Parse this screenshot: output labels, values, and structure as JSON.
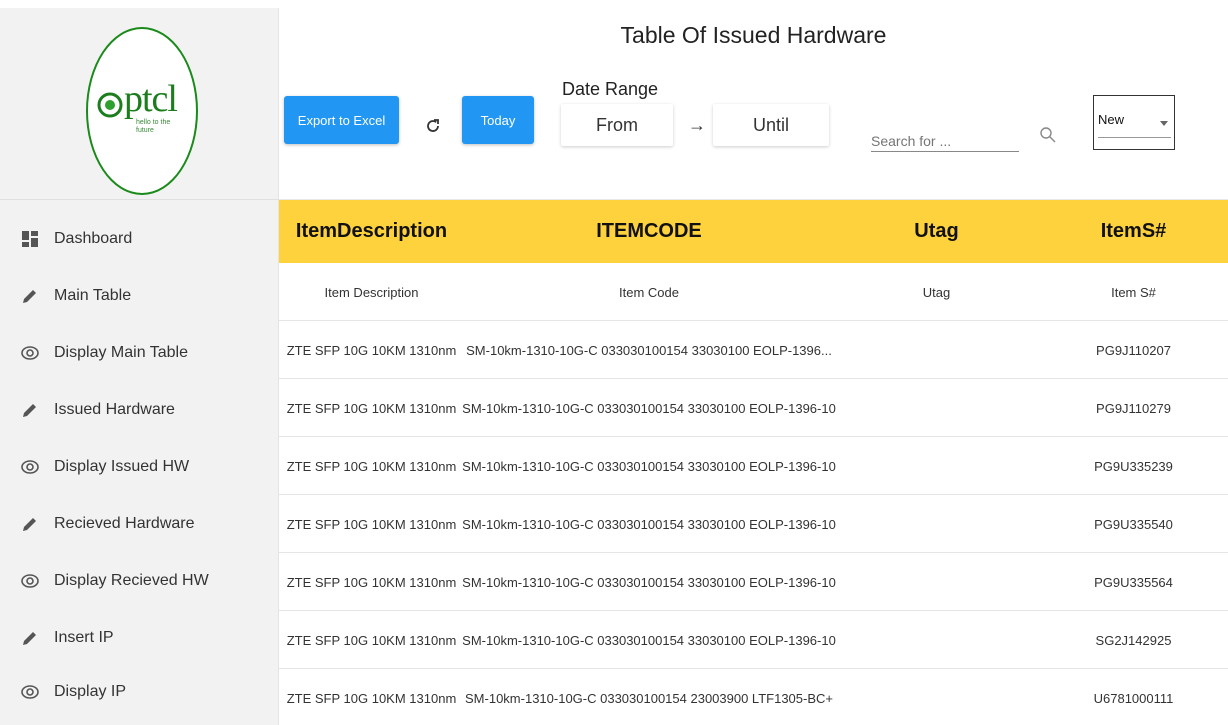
{
  "logo": {
    "text": "ptcl",
    "tagline": "hello to the\nfuture",
    "brand_color": "#1b7d1b"
  },
  "sidebar": {
    "items": [
      {
        "label": "Dashboard",
        "icon": "dashboard-icon"
      },
      {
        "label": "Main Table",
        "icon": "pencil-icon"
      },
      {
        "label": "Display Main Table",
        "icon": "eye-icon"
      },
      {
        "label": "Issued Hardware",
        "icon": "pencil-icon"
      },
      {
        "label": "Display Issued HW",
        "icon": "eye-icon"
      },
      {
        "label": "Recieved Hardware",
        "icon": "pencil-icon"
      },
      {
        "label": "Display Recieved HW",
        "icon": "eye-icon"
      },
      {
        "label": "Insert IP",
        "icon": "pencil-icon"
      },
      {
        "label": "Display IP",
        "icon": "eye-icon"
      }
    ]
  },
  "header": {
    "title": "Table Of Issued Hardware",
    "export_label": "Export to Excel",
    "today_label": "Today",
    "date_range_label": "Date Range",
    "from_label": "From",
    "arrow": "→",
    "until_label": "Until",
    "search_placeholder": "Search for ...",
    "status_value": "New"
  },
  "colors": {
    "accent_blue": "#2196f3",
    "header_yellow": "#fdd23d"
  },
  "table": {
    "columns": [
      "ItemDescription",
      "ITEMCODE",
      "Utag",
      "ItemS#"
    ],
    "filter_row": [
      "Item Description",
      "Item Code",
      "Utag",
      "Item S#"
    ],
    "rows": [
      [
        "ZTE SFP 10G 10KM 1310nm",
        "SM-10km-1310-10G-C 033030100154 33030100 EOLP-1396...",
        "",
        "PG9J110207"
      ],
      [
        "ZTE SFP 10G 10KM 1310nm",
        "SM-10km-1310-10G-C 033030100154 33030100 EOLP-1396-10",
        "",
        "PG9J110279"
      ],
      [
        "ZTE SFP 10G 10KM 1310nm",
        "SM-10km-1310-10G-C 033030100154 33030100 EOLP-1396-10",
        "",
        "PG9U335239"
      ],
      [
        "ZTE SFP 10G 10KM 1310nm",
        "SM-10km-1310-10G-C 033030100154 33030100 EOLP-1396-10",
        "",
        "PG9U335540"
      ],
      [
        "ZTE SFP 10G 10KM 1310nm",
        "SM-10km-1310-10G-C 033030100154 33030100 EOLP-1396-10",
        "",
        "PG9U335564"
      ],
      [
        "ZTE SFP 10G 10KM 1310nm",
        "SM-10km-1310-10G-C 033030100154 33030100 EOLP-1396-10",
        "",
        "SG2J142925"
      ],
      [
        "ZTE SFP 10G 10KM 1310nm",
        "SM-10km-1310-10G-C 033030100154 23003900 LTF1305-BC+",
        "",
        "U6781000111"
      ]
    ]
  }
}
